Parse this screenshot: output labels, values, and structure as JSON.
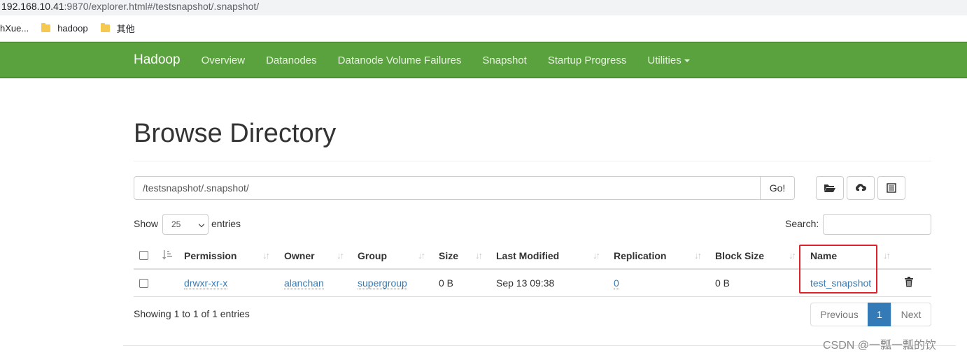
{
  "browser": {
    "address_host": "192.168.10.41",
    "address_path": ":9870/explorer.html#/testsnapshot/.snapshot/",
    "bookmarks": [
      {
        "label": "hXue..."
      },
      {
        "label": "hadoop"
      },
      {
        "label": "其他"
      }
    ]
  },
  "navbar": {
    "brand": "Hadoop",
    "items": [
      "Overview",
      "Datanodes",
      "Datanode Volume Failures",
      "Snapshot",
      "Startup Progress",
      "Utilities"
    ],
    "background": "#5aa23e"
  },
  "page": {
    "title": "Browse Directory",
    "path_value": "/testsnapshot/.snapshot/",
    "go_label": "Go!",
    "show_label": "Show",
    "entries_value": "25",
    "entries_label": "entries",
    "search_label": "Search:",
    "search_value": ""
  },
  "table": {
    "columns": [
      "Permission",
      "Owner",
      "Group",
      "Size",
      "Last Modified",
      "Replication",
      "Block Size",
      "Name"
    ],
    "rows": [
      {
        "permission": "drwxr-xr-x",
        "owner": "alanchan",
        "group": "supergroup",
        "size": "0 B",
        "last_modified": "Sep 13 09:38",
        "replication": "0",
        "block_size": "0 B",
        "name": "test_snapshot"
      }
    ],
    "summary": "Showing 1 to 1 of 1 entries"
  },
  "pagination": {
    "previous": "Previous",
    "current": "1",
    "next": "Next"
  },
  "watermark": "CSDN @一瓢一瓢的饮",
  "colors": {
    "link": "#337ab7",
    "highlight": "#e0202a"
  }
}
